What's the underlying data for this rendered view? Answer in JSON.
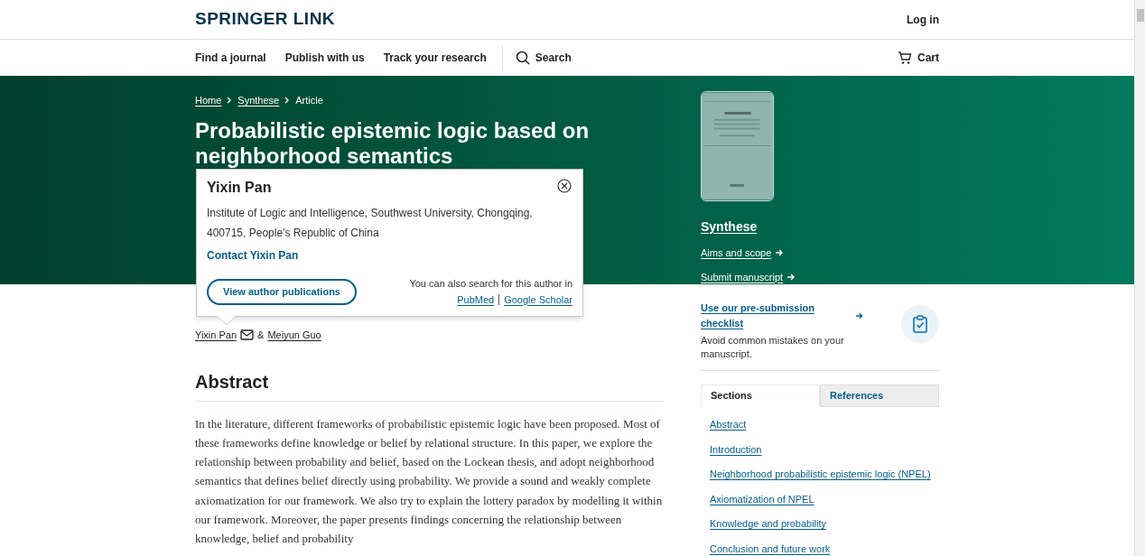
{
  "header": {
    "logo": "SPRINGER LINK",
    "login": "Log in"
  },
  "nav": {
    "items": [
      "Find a journal",
      "Publish with us",
      "Track your research"
    ],
    "search": "Search",
    "cart": "Cart"
  },
  "breadcrumbs": [
    "Home",
    "Synthese",
    "Article"
  ],
  "title": "Probabilistic epistemic logic based on neighborhood semantics",
  "journal": {
    "cover": {
      "kind": "picture"
    },
    "name": "Synthese",
    "links": [
      "Aims and scope",
      "Submit manuscript"
    ]
  },
  "author_popover": {
    "name": "Yixin Pan",
    "affiliation": "Institute of Logic and Intelligence, Southwest University, Chongqing, 400715, People’s Republic of China",
    "contact": "Contact Yixin Pan",
    "button": "View author publications",
    "search_note": "You can also search for this author in",
    "search_links": [
      "PubMed",
      "Google Scholar"
    ]
  },
  "authors": [
    {
      "name": "Yixin Pan",
      "email": true
    },
    {
      "name": "Meiyun Guo",
      "email": false
    }
  ],
  "author_separator": "&",
  "abstract": {
    "heading": "Abstract",
    "text": "In the literature, different frameworks of probabilistic epistemic logic have been proposed. Most of these frameworks define knowledge or belief by relational structure. In this paper, we explore the relationship between probability and belief, based on the Lockean thesis, and adopt neighborhood semantics that defines belief directly using probability. We provide a sound and weakly complete axiomatization for our framework. We also try to explain the lottery paradox by modelling it within our framework. Moreover, the paper presents findings concerning the relationship between knowledge, belief and probability"
  },
  "checklist": {
    "link": "Use our pre-submission checklist",
    "text": "Avoid common mistakes on your manuscript."
  },
  "tabs": [
    {
      "label": "Sections",
      "selected": true
    },
    {
      "label": "References",
      "selected": false
    }
  ],
  "sections": [
    "Abstract",
    "Introduction",
    "Neighborhood probabilistic epistemic logic (NPEL)",
    "Axiomatization of NPEL",
    "Knowledge and probability",
    "Conclusion and future work"
  ]
}
